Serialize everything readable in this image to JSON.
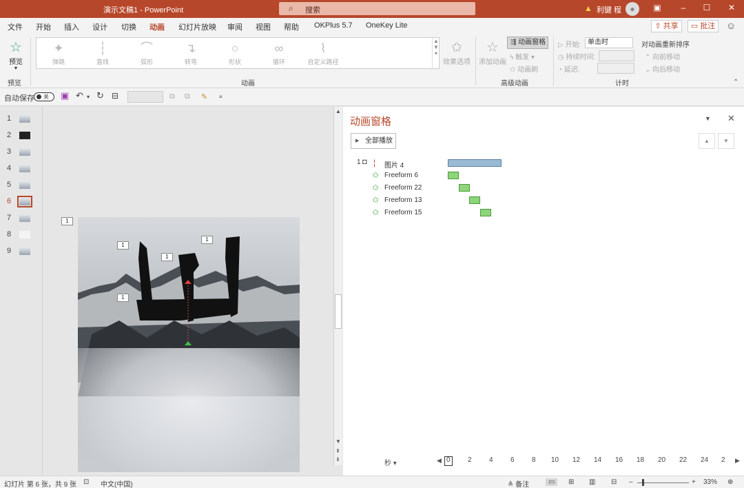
{
  "titlebar": {
    "doc_title": "演示文稿1  -  PowerPoint",
    "search_placeholder": "搜索",
    "user_name": "利键 程",
    "warning_icon": "warning-icon",
    "avatar_icon": "user-avatar-icon"
  },
  "menu": {
    "tabs": [
      "文件",
      "开始",
      "插入",
      "设计",
      "切换",
      "动画",
      "幻灯片放映",
      "审阅",
      "视图",
      "帮助",
      "OKPlus 5.7",
      "OneKey Lite"
    ],
    "active_tab": "动画",
    "share": "共享",
    "comment": "批注"
  },
  "ribbon": {
    "preview_label": "预览",
    "preview_group": "预览",
    "animations": [
      "弹跳",
      "直线",
      "弧形",
      "转弯",
      "形状",
      "循环",
      "自定义路径"
    ],
    "animation_group": "动画",
    "effect_options": "效果选项",
    "add_animation": "添加动画",
    "animation_pane": "动画窗格",
    "trigger": "触发",
    "animation_painter": "动画刷",
    "advanced_group": "高级动画",
    "start_label": "开始:",
    "start_value": "单击时",
    "duration_label": "持续时间:",
    "delay_label": "延迟:",
    "timing_group": "计时",
    "reorder_title": "对动画重新排序",
    "move_earlier": "向前移动",
    "move_later": "向后移动"
  },
  "qat": {
    "autosave_label": "自动保存",
    "autosave_state": "关"
  },
  "thumbnails": [
    "1",
    "2",
    "3",
    "4",
    "5",
    "6",
    "7",
    "8",
    "9"
  ],
  "active_slide": "6",
  "slide": {
    "slide_tag": "1",
    "tags": [
      "1",
      "1",
      "1",
      "1"
    ]
  },
  "pane": {
    "title": "动画窗格",
    "play_all": "全部播放",
    "items": [
      {
        "seq": "1",
        "name": "图片 4"
      },
      {
        "seq": "",
        "name": "Freeform 6"
      },
      {
        "seq": "",
        "name": "Freeform 22"
      },
      {
        "seq": "",
        "name": "Freeform 13"
      },
      {
        "seq": "",
        "name": "Freeform 15"
      }
    ],
    "seconds_label": "秒",
    "timeline_ticks": [
      "0",
      "2",
      "4",
      "6",
      "8",
      "10",
      "12",
      "14",
      "16",
      "18",
      "20",
      "22",
      "24",
      "2"
    ]
  },
  "status": {
    "slide_info": "幻灯片 第 6 张，共 9 张",
    "language": "中文(中国)",
    "notes": "备注",
    "zoom": "33%"
  },
  "colors": {
    "accent": "#b7472a",
    "bar_blue": "#9bbbd4",
    "bar_green": "#8ed47a"
  }
}
